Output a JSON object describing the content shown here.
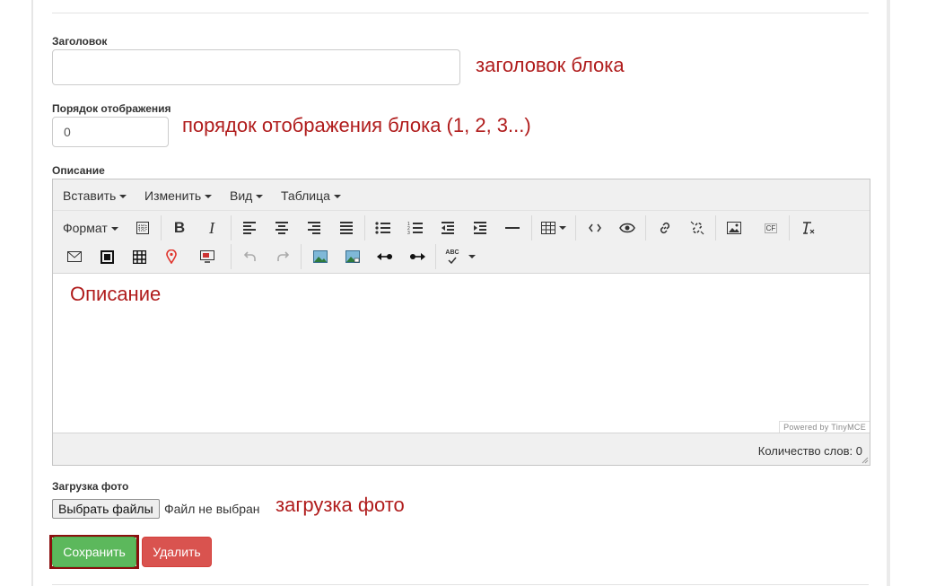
{
  "form": {
    "title_label": "Заголовок",
    "title_value": "",
    "order_label": "Порядок отображения",
    "order_value": "0",
    "description_label": "Описание",
    "photo_label": "Загрузка фото",
    "file_button": "Выбрать файлы",
    "file_status": "Файл не выбран",
    "save_button": "Сохранить",
    "delete_button": "Удалить"
  },
  "annotations": {
    "title_note": "заголовок блока",
    "order_note": "порядок отображения блока (1, 2, 3...)",
    "photo_note": "загрузка фото"
  },
  "editor": {
    "menus": [
      "Вставить",
      "Изменить",
      "Вид",
      "Таблица"
    ],
    "format_label": "Формат",
    "content_text": "Описание",
    "powered_by": "Powered by TinyMCE",
    "word_count": "Количество слов: 0",
    "cf_label": "CF",
    "abc_label": "ABC"
  },
  "colors": {
    "annotation": "#b01c1c",
    "save": "#5cb85c",
    "delete": "#d9534f",
    "highlight_border": "#8b0f0f"
  }
}
